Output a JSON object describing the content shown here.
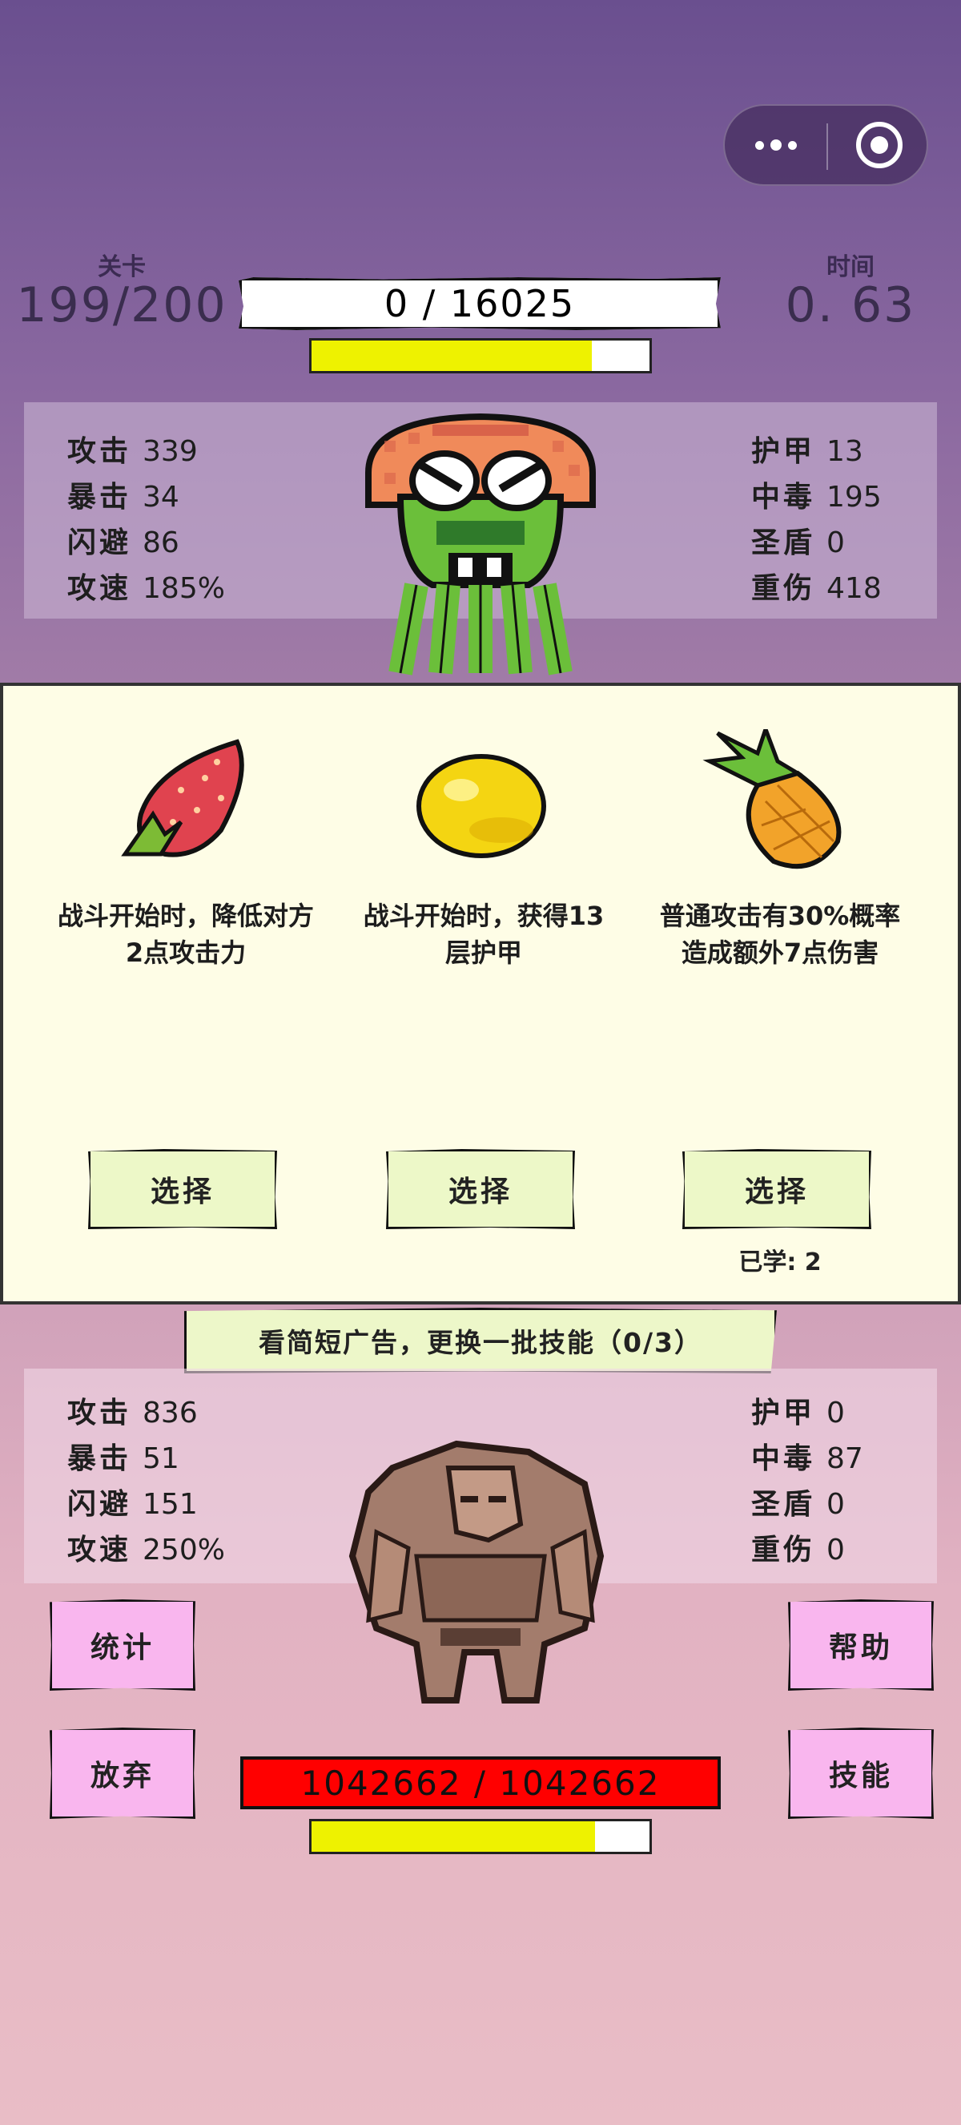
{
  "capsule": {
    "more_icon": "more-dots-icon",
    "close_icon": "target-circle-icon"
  },
  "header": {
    "level_label": "关卡",
    "level_value": "199/200",
    "time_label": "时间",
    "time_value": "0. 63",
    "player_hp_text": "0  /  16025",
    "player_bar_fraction": 0.83
  },
  "player_stats": {
    "left": [
      {
        "k": "攻击",
        "v": "339"
      },
      {
        "k": "暴击",
        "v": "34"
      },
      {
        "k": "闪避",
        "v": "86"
      },
      {
        "k": "攻速",
        "v": "185%"
      }
    ],
    "right": [
      {
        "k": "护甲",
        "v": "13"
      },
      {
        "k": "中毒",
        "v": "195"
      },
      {
        "k": "圣盾",
        "v": "0"
      },
      {
        "k": "重伤",
        "v": "418"
      }
    ]
  },
  "choices": [
    {
      "icon": "strawberry-icon",
      "desc": "战斗开始时，降低对方2点攻击力",
      "button": "选择"
    },
    {
      "icon": "lemon-icon",
      "desc": "战斗开始时，获得13层护甲",
      "button": "选择"
    },
    {
      "icon": "pineapple-icon",
      "desc": "普通攻击有30%概率造成额外7点伤害",
      "button": "选择"
    }
  ],
  "learned_text": "已学: 2",
  "ad_text": "看简短广告，更换一批技能（0/3）",
  "enemy_stats": {
    "left": [
      {
        "k": "攻击",
        "v": "836"
      },
      {
        "k": "暴击",
        "v": "51"
      },
      {
        "k": "闪避",
        "v": "151"
      },
      {
        "k": "攻速",
        "v": "250%"
      }
    ],
    "right": [
      {
        "k": "护甲",
        "v": "0"
      },
      {
        "k": "中毒",
        "v": "87"
      },
      {
        "k": "圣盾",
        "v": "0"
      },
      {
        "k": "重伤",
        "v": "0"
      }
    ]
  },
  "buttons": {
    "stats": "统计",
    "help": "帮助",
    "giveup": "放弃",
    "skills": "技能"
  },
  "enemy_hp_text": "1042662  /  1042662",
  "enemy_bar_fraction": 0.84,
  "colors": {
    "hp_bar_fill": "#eef200",
    "enemy_hp_bg": "#ff0000",
    "side_buttons": "#f9b6ee",
    "choose_buttons": "#edf8c8",
    "card_bg": "#fefde6"
  }
}
